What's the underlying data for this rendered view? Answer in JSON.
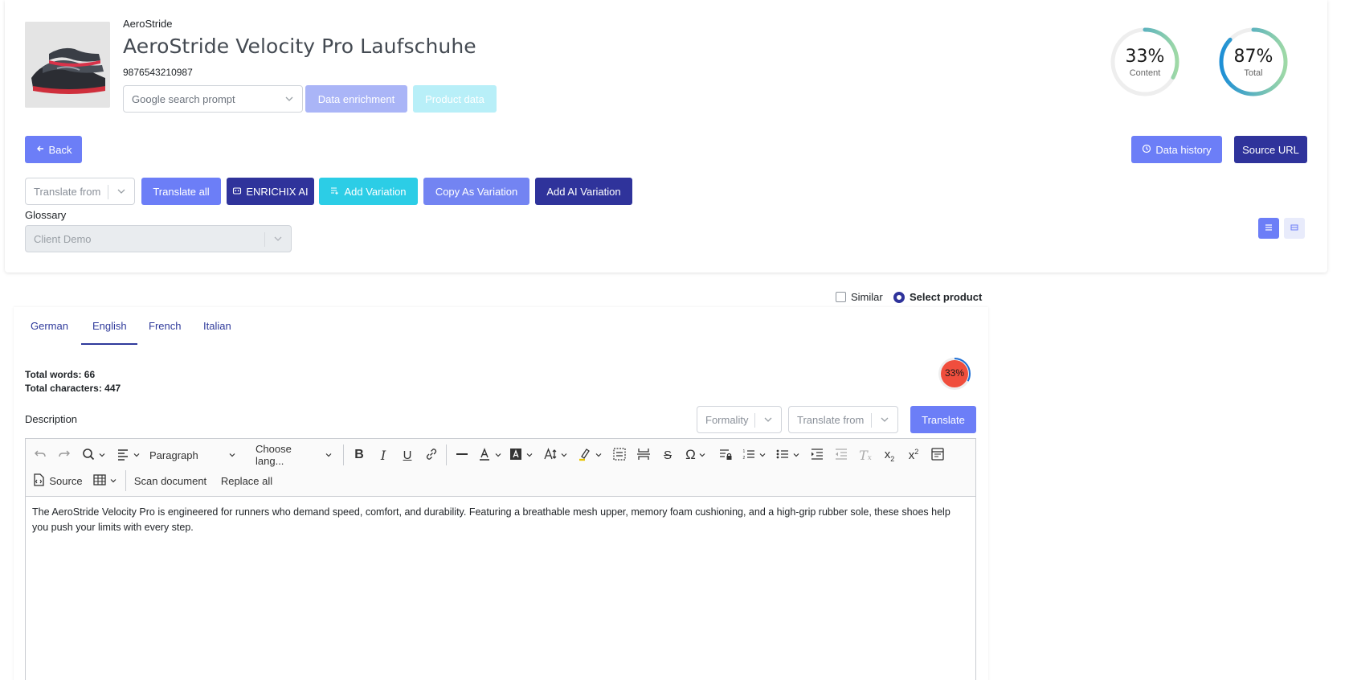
{
  "product": {
    "brand": "AeroStride",
    "title": "AeroStride Velocity Pro Laufschuhe",
    "ean": "9876543210987"
  },
  "header": {
    "prompt_select": "Google search prompt",
    "data_enrichment": "Data enrichment",
    "product_data": "Product data",
    "back": "Back",
    "data_history": "Data history",
    "source_url": "Source URL"
  },
  "gauges": [
    {
      "value": "33%",
      "label": "Content",
      "percent": 33
    },
    {
      "value": "87%",
      "label": "Total",
      "percent": 87
    }
  ],
  "actions": {
    "translate_from": "Translate from",
    "translate_all": "Translate all",
    "enrichix_ai": "ENRICHIX AI",
    "add_variation": "Add Variation",
    "copy_as_variation": "Copy As Variation",
    "add_ai_variation": "Add AI Variation"
  },
  "glossary": {
    "label": "Glossary",
    "value": "Client Demo"
  },
  "options": {
    "similar": "Similar",
    "select_product": "Select product"
  },
  "tabs": [
    {
      "label": "German"
    },
    {
      "label": "English"
    },
    {
      "label": "French"
    },
    {
      "label": "Italian"
    }
  ],
  "stats": {
    "words": "Total words: 66",
    "characters": "Total characters: 447",
    "score": "33%",
    "score_percent": 33
  },
  "description": {
    "label": "Description",
    "formality": "Formality",
    "translate_from": "Translate from",
    "translate": "Translate"
  },
  "editor": {
    "paragraph": "Paragraph",
    "language": "Choose lang...",
    "source": "Source",
    "scan_document": "Scan document",
    "replace_all": "Replace all",
    "content": "The AeroStride Velocity Pro is engineered for runners who demand speed, comfort, and durability. Featuring a breathable mesh upper, memory foam cushioning, and a high-grip rubber sole, these shoes help you push your limits with every step."
  },
  "colors": {
    "primary": "#6c7ef7",
    "dark": "#2f339b",
    "cyan": "#2ccde6",
    "light_primary": "#aab5f7",
    "light_cyan": "#b8eff8",
    "score_red": "#f04e3d"
  }
}
